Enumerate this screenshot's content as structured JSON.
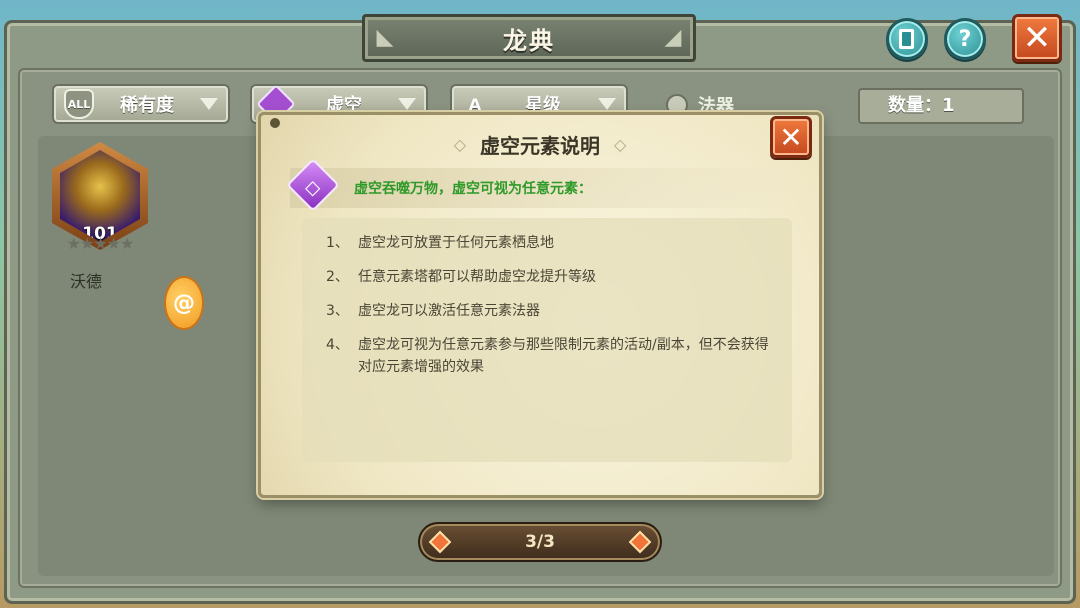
{
  "header": {
    "title": "龙典",
    "book_icon": "book-icon",
    "help_icon": "question-icon",
    "close_icon": "close-icon",
    "help_glyph": "?",
    "close_glyph": "✕"
  },
  "filters": {
    "rarity": {
      "badge": "ALL",
      "label": "稀有度"
    },
    "element": {
      "label": "虚空"
    },
    "star": {
      "badge": "A",
      "label": "星级"
    },
    "artifact": {
      "label": "法器"
    },
    "count_label": "数量：1"
  },
  "dragons": [
    {
      "name": "沃德",
      "level": "101",
      "stars": "★★★★★"
    }
  ],
  "token_glyph": "@",
  "pager": {
    "text": "3/3"
  },
  "popup": {
    "title": "虚空元素说明",
    "title_ornament": "◇",
    "close_glyph": "✕",
    "intro": "虚空吞噬万物，虚空可视为任意元素：",
    "rules": [
      {
        "num": "1、",
        "text": "虚空龙可放置于任何元素栖息地"
      },
      {
        "num": "2、",
        "text": "任意元素塔都可以帮助虚空龙提升等级"
      },
      {
        "num": "3、",
        "text": "虚空龙可以激活任意元素法器"
      },
      {
        "num": "4、",
        "text": "虚空龙可视为任意元素参与那些限制元素的活动/副本，但不会获得对应元素增强的效果"
      }
    ]
  },
  "colors": {
    "accent_close": "#e0622c",
    "intro_green": "#2f9a2a",
    "void_purple": "#a44fd1"
  }
}
